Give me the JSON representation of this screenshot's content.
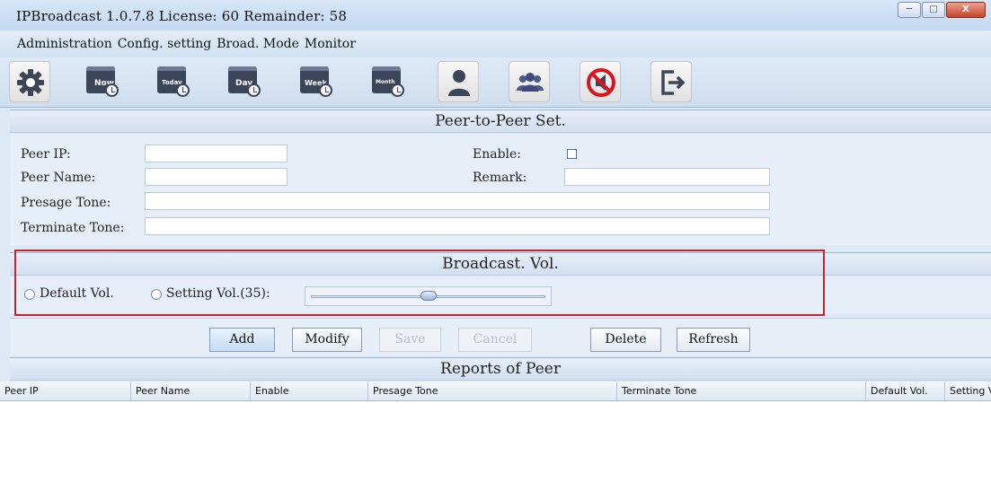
{
  "window": {
    "title": "IPBroadcast 1.0.7.8 License: 60 Remainder: 58",
    "controls": [
      "minimize",
      "maximize",
      "close"
    ]
  },
  "menu": [
    "Administration",
    "Config. setting",
    "Broad. Mode",
    "Monitor"
  ],
  "toolbar": {
    "tools": [
      {
        "icon": "gear-icon"
      },
      {
        "icon": "calendar-clock-icon",
        "label": "Now"
      },
      {
        "icon": "calendar-clock-icon",
        "label": "Today"
      },
      {
        "icon": "calendar-clock-icon",
        "label": "Day"
      },
      {
        "icon": "calendar-clock-icon",
        "label": "Week"
      },
      {
        "icon": "calendar-clock-icon",
        "label": "Month"
      },
      {
        "icon": "user-icon"
      },
      {
        "icon": "users-group-icon"
      },
      {
        "icon": "mute-speaker-icon"
      },
      {
        "icon": "exit-icon"
      }
    ]
  },
  "peer_set": {
    "header": "Peer-to-Peer Set.",
    "peer_ip_label": "Peer IP:",
    "peer_ip_value": "",
    "peer_name_label": "Peer Name:",
    "peer_name_value": "",
    "presage_tone_label": "Presage Tone:",
    "presage_tone_value": "",
    "terminate_tone_label": "Terminate Tone:",
    "terminate_tone_value": "",
    "enable_label": "Enable:",
    "enable_checked": false,
    "remark_label": "Remark:",
    "remark_value": ""
  },
  "broadcast_vol": {
    "header": "Broadcast. Vol.",
    "default_label": "Default Vol.",
    "setting_label": "Setting Vol.(35):",
    "setting_value": 35,
    "slider_fraction": 0.5
  },
  "actions": {
    "add": "Add",
    "modify": "Modify",
    "save": "Save",
    "cancel": "Cancel",
    "delete": "Delete",
    "refresh": "Refresh"
  },
  "reports": {
    "header": "Reports of Peer",
    "columns": [
      "Peer IP",
      "Peer Name",
      "Enable",
      "Presage Tone",
      "Terminate Tone",
      "Default Vol.",
      "Setting Vol."
    ],
    "rows": []
  },
  "colors": {
    "highlight_frame": "#c4242b",
    "panel_bg": "#e6eef8"
  }
}
